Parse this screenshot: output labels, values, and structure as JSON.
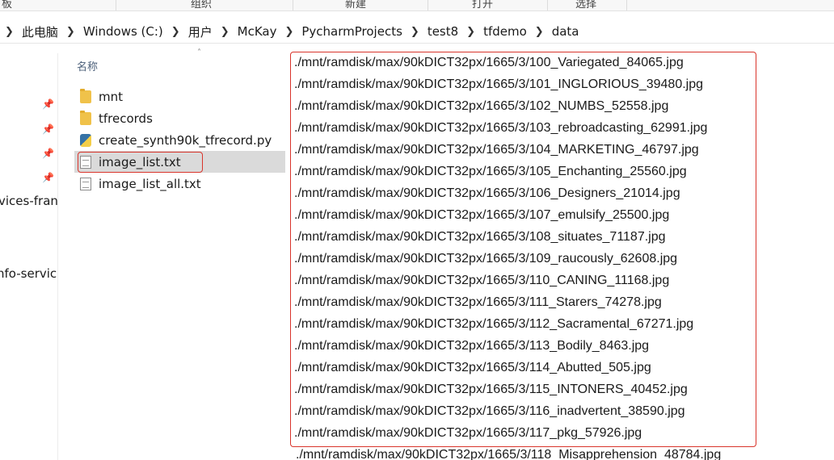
{
  "ribbon": {
    "left_fragment": "板",
    "groups": [
      "组织",
      "新建",
      "打开",
      "选择"
    ]
  },
  "address": {
    "crumbs": [
      "此电脑",
      "Windows (C:)",
      "用户",
      "McKay",
      "PycharmProjects",
      "test8",
      "tfdemo",
      "data"
    ]
  },
  "nav": {
    "fragments": [
      "vices-fran",
      "nfo-service"
    ]
  },
  "file_list": {
    "column_header": "名称",
    "items": [
      {
        "name": "mnt",
        "icon": "folder-icon"
      },
      {
        "name": "tfrecords",
        "icon": "folder-icon"
      },
      {
        "name": "create_synth90k_tfrecord.py",
        "icon": "python-file-icon"
      },
      {
        "name": "image_list.txt",
        "icon": "text-file-icon",
        "selected": true
      },
      {
        "name": "image_list_all.txt",
        "icon": "text-file-icon"
      }
    ]
  },
  "content": {
    "lines": [
      "./mnt/ramdisk/max/90kDICT32px/1665/3/100_Variegated_84065.jpg",
      "./mnt/ramdisk/max/90kDICT32px/1665/3/101_INGLORIOUS_39480.jpg",
      "./mnt/ramdisk/max/90kDICT32px/1665/3/102_NUMBS_52558.jpg",
      "./mnt/ramdisk/max/90kDICT32px/1665/3/103_rebroadcasting_62991.jpg",
      "./mnt/ramdisk/max/90kDICT32px/1665/3/104_MARKETING_46797.jpg",
      "./mnt/ramdisk/max/90kDICT32px/1665/3/105_Enchanting_25560.jpg",
      "./mnt/ramdisk/max/90kDICT32px/1665/3/106_Designers_21014.jpg",
      "./mnt/ramdisk/max/90kDICT32px/1665/3/107_emulsify_25500.jpg",
      "./mnt/ramdisk/max/90kDICT32px/1665/3/108_situates_71187.jpg",
      "./mnt/ramdisk/max/90kDICT32px/1665/3/109_raucously_62608.jpg",
      "./mnt/ramdisk/max/90kDICT32px/1665/3/110_CANING_11168.jpg",
      "./mnt/ramdisk/max/90kDICT32px/1665/3/111_Starers_74278.jpg",
      "./mnt/ramdisk/max/90kDICT32px/1665/3/112_Sacramental_67271.jpg",
      "./mnt/ramdisk/max/90kDICT32px/1665/3/113_Bodily_8463.jpg",
      "./mnt/ramdisk/max/90kDICT32px/1665/3/114_Abutted_505.jpg",
      "./mnt/ramdisk/max/90kDICT32px/1665/3/115_INTONERS_40452.jpg",
      "./mnt/ramdisk/max/90kDICT32px/1665/3/116_inadvertent_38590.jpg",
      "./mnt/ramdisk/max/90kDICT32px/1665/3/117_pkg_57926.jpg"
    ],
    "overflow_line": "./mnt/ramdisk/max/90kDICT32px/1665/3/118_Misapprehension_48784.jpg"
  },
  "colors": {
    "highlight_border": "#d9342b",
    "selection_bg": "#dadada"
  }
}
